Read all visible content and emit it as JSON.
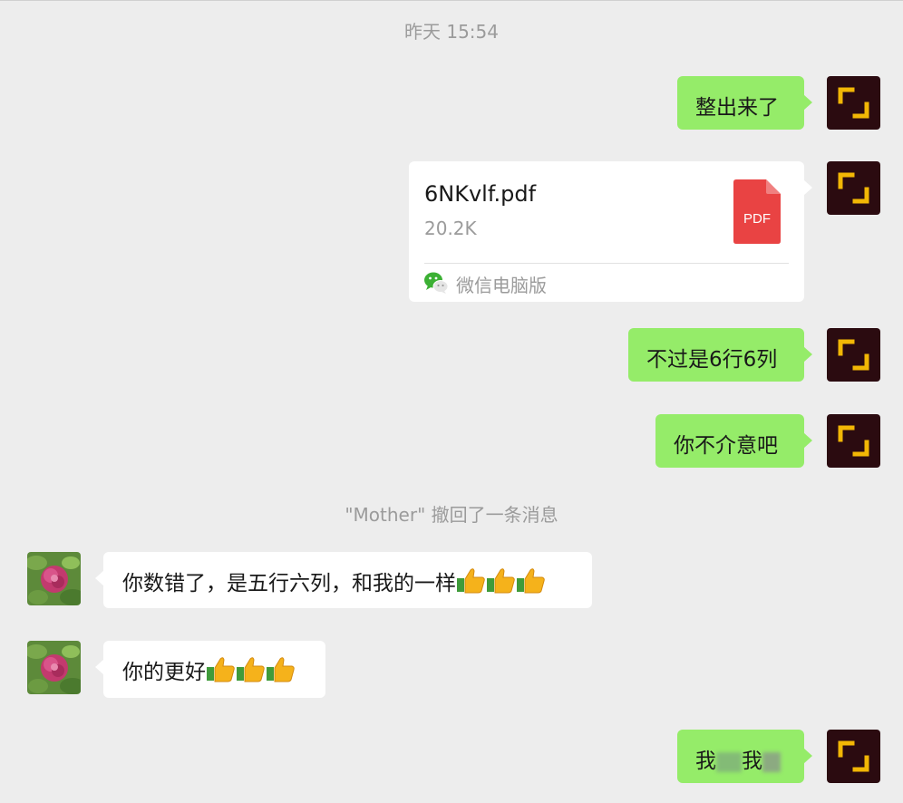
{
  "chat": {
    "timestamp": "昨天 15:54",
    "recall_notice": "\"Mother\" 撤回了一条消息"
  },
  "messages": {
    "m1": {
      "text": "整出来了"
    },
    "file": {
      "name": "6NKvlf.pdf",
      "size": "20.2K",
      "source": "微信电脑版",
      "icon_label": "PDF",
      "icon_color": "#e94343"
    },
    "m3": {
      "text": "不过是6行6列"
    },
    "m4": {
      "text": "你不介意吧"
    },
    "o1": {
      "text": "你数错了，是五行六列，和我的一样"
    },
    "o2": {
      "text": "你的更好"
    },
    "m5": {
      "text_start": "我",
      "text_mid": "我"
    }
  },
  "colors": {
    "my_bubble": "#95ec69",
    "other_bubble": "#ffffff",
    "background": "#ededed",
    "my_avatar": "#2b0b10",
    "my_avatar_accent": "#f2b705"
  },
  "icons": {
    "my_avatar": "yellow-corner-brackets-icon",
    "other_avatar": "peony-flower-photo",
    "file_type": "pdf-file-icon",
    "file_source": "wechat-logo-icon",
    "emoji": "thumbs-up-emoji"
  }
}
